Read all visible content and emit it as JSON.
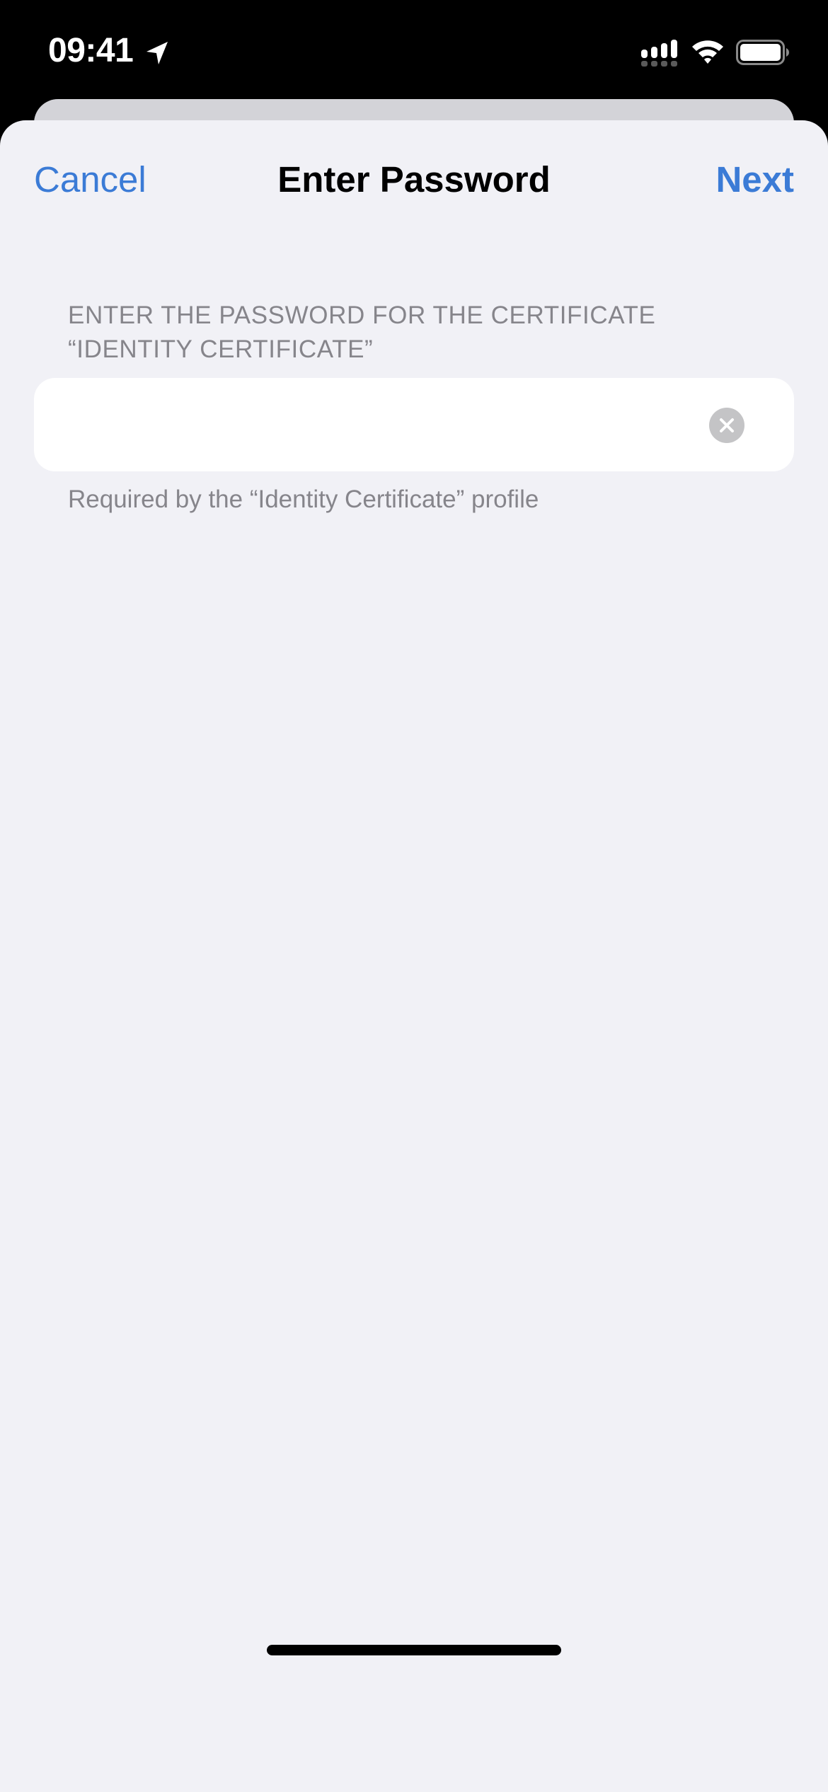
{
  "status_bar": {
    "time": "09:41",
    "icons": {
      "location": "location-arrow-icon",
      "signal": "cellular-signal-icon",
      "wifi": "wifi-icon",
      "battery": "battery-icon"
    },
    "signal_bars": 4,
    "battery_level": "full"
  },
  "nav": {
    "cancel_label": "Cancel",
    "title": "Enter Password",
    "next_label": "Next"
  },
  "form": {
    "section_header": "ENTER THE PASSWORD FOR THE CERTIFICATE “IDENTITY CERTIFICATE”",
    "password_value": "",
    "password_placeholder": "",
    "clear_icon": "clear-x-circle-icon",
    "section_footer": "Required by the “Identity Certificate” profile"
  },
  "colors": {
    "accent": "#3b7bd6",
    "background": "#f1f1f6",
    "secondary_text": "#86858b",
    "cell": "#ffffff"
  }
}
